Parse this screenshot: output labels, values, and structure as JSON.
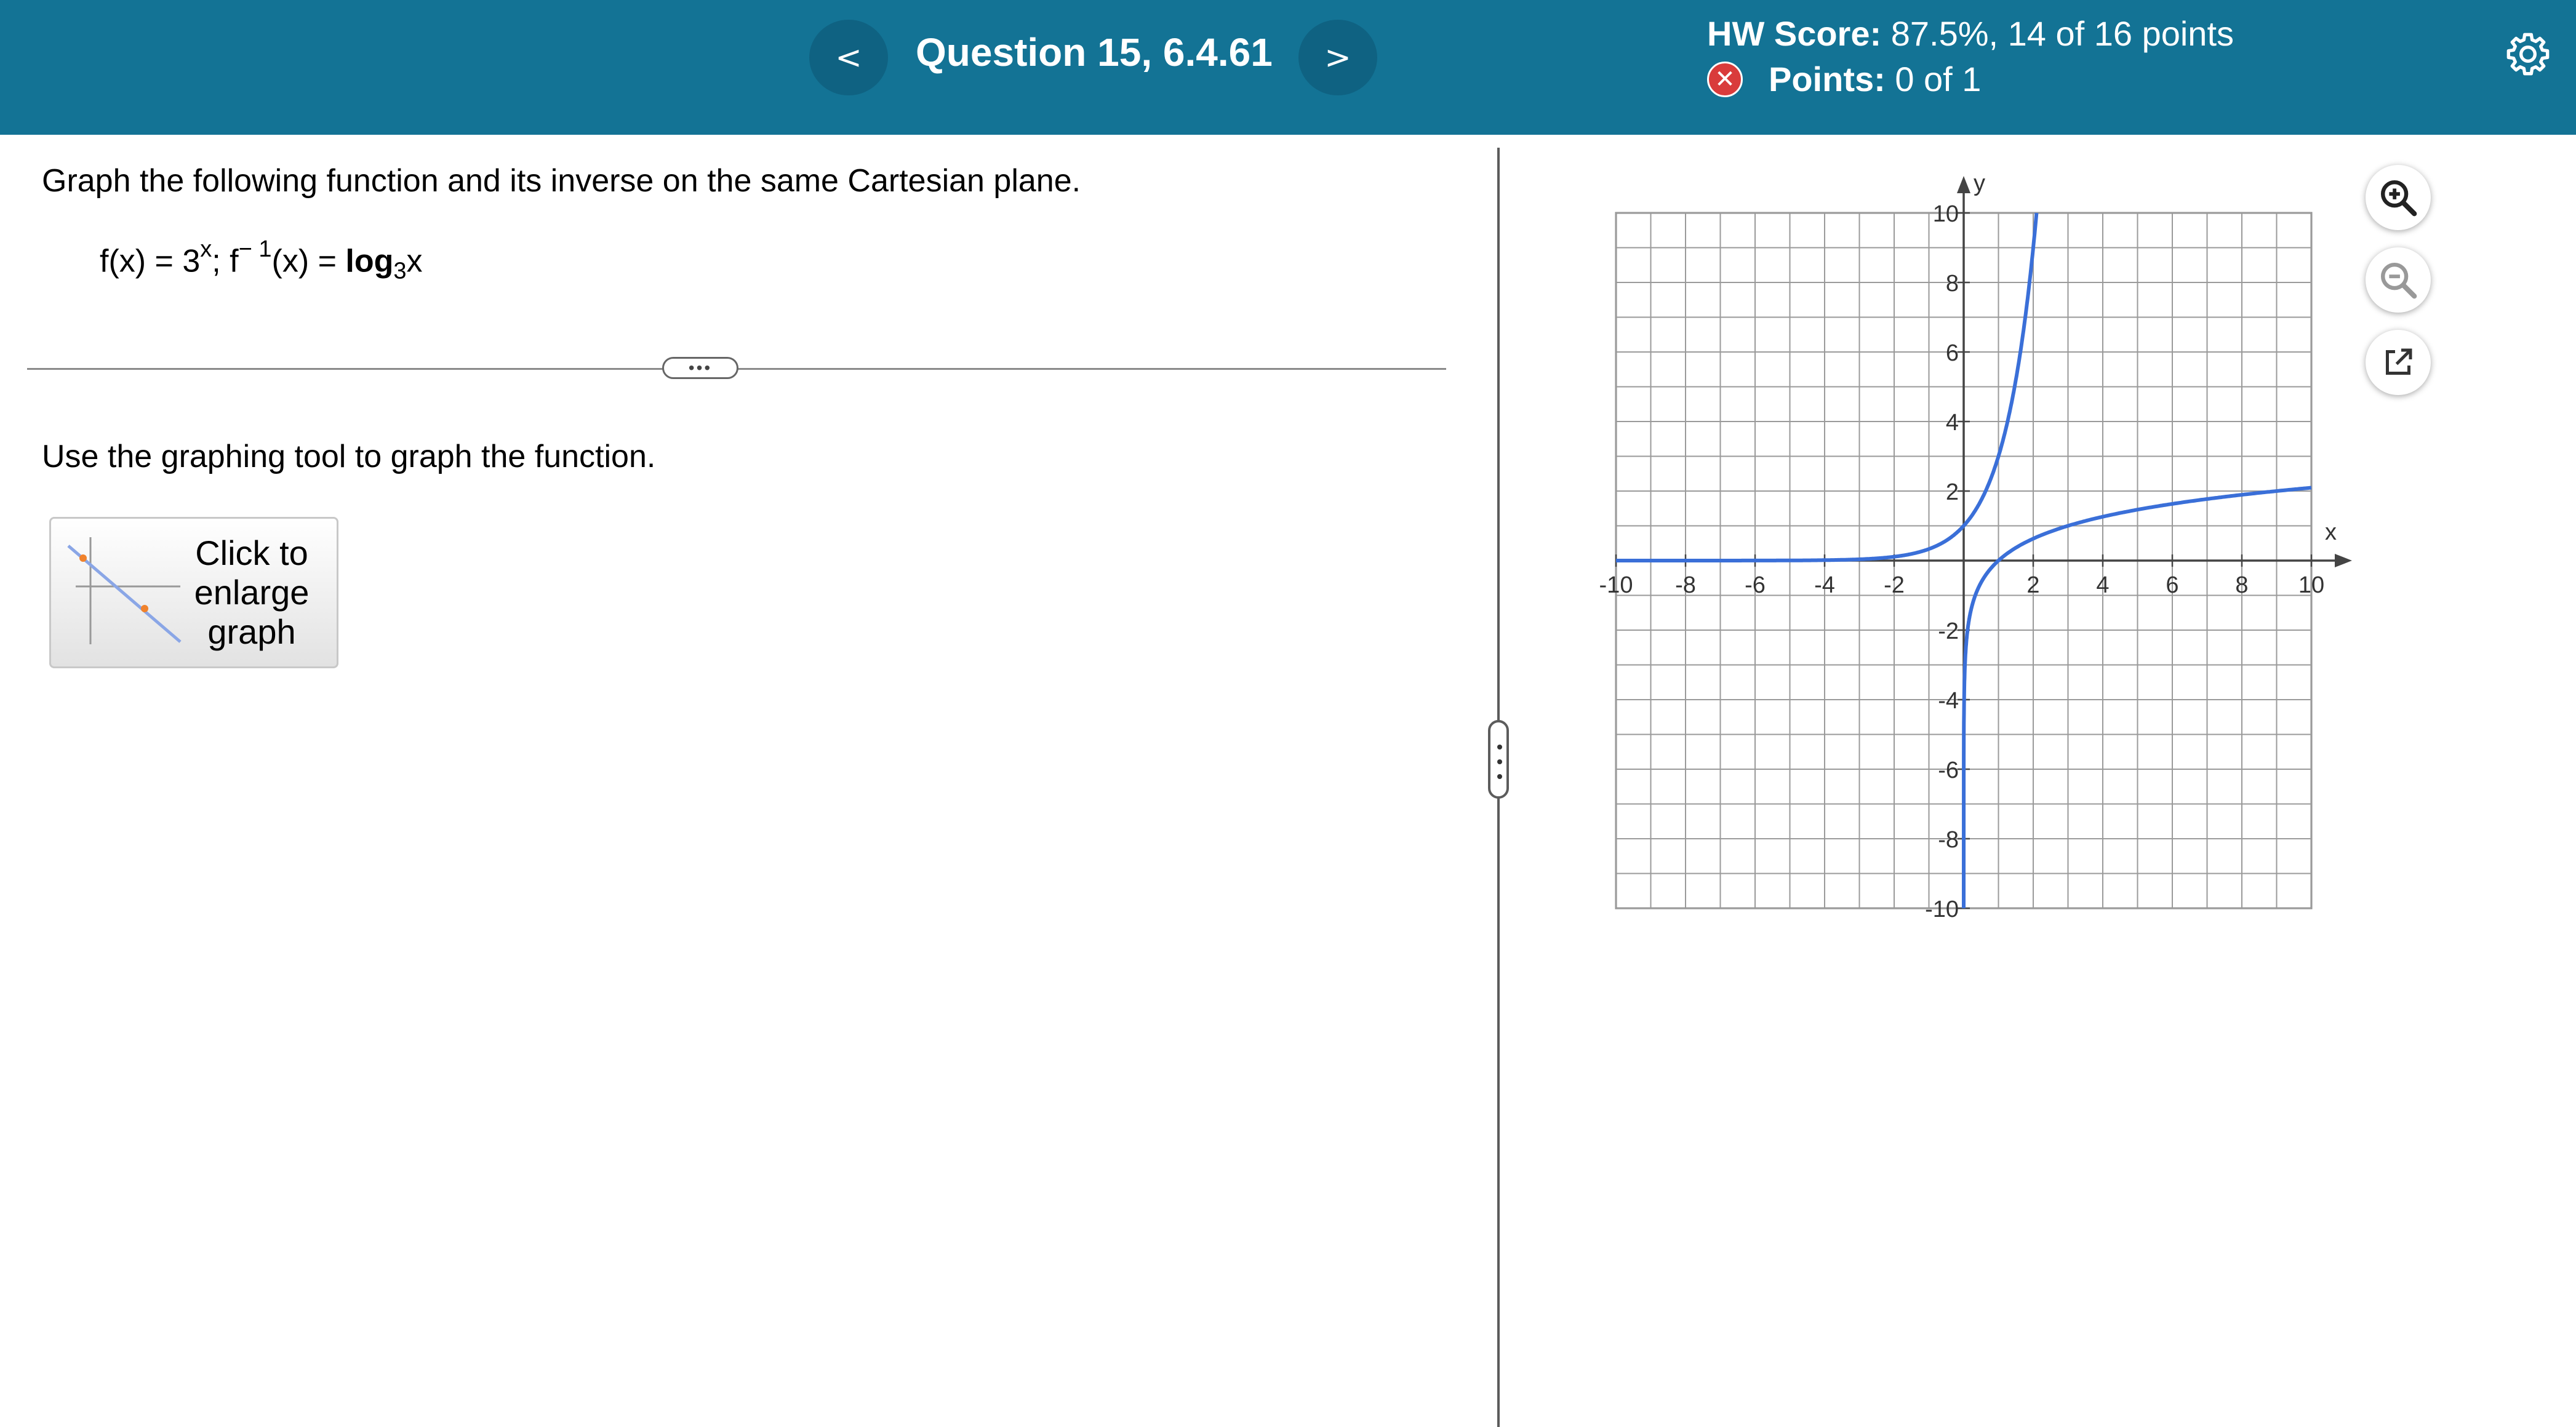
{
  "header": {
    "prev_label": "<",
    "next_label": ">",
    "question_title": "Question 15, 6.4.61",
    "hw_score_label": "HW Score:",
    "hw_score_value": "87.5%, 14 of 16 points",
    "points_label": "Points:",
    "points_value": "0 of 1",
    "points_status_icon": "x-circle-icon",
    "settings_icon": "gear-icon"
  },
  "problem": {
    "instruction": "Graph the following function and its inverse on the same Cartesian plane.",
    "f_lhs": "f(x) = 3",
    "f_exp": "x",
    "sep": "; f",
    "inv_sup": "− 1",
    "inv_lhs": "(x) = ",
    "log_word": "log",
    "log_base": "3",
    "log_arg": "x",
    "more_label": "•••",
    "tool_instruction": "Use the graphing tool to graph the function.",
    "enlarge_label": "Click to enlarge graph"
  },
  "chart_data": {
    "type": "line",
    "x_label": "x",
    "y_label": "y",
    "xlim": [
      -10,
      10
    ],
    "ylim": [
      -10,
      10
    ],
    "grid": true,
    "grid_step": 1,
    "x_ticks": [
      "-10",
      "-8",
      "-6",
      "-4",
      "-2",
      "2",
      "4",
      "6",
      "8",
      "10"
    ],
    "y_ticks": [
      "10",
      "8",
      "6",
      "4",
      "2",
      "-2",
      "-4",
      "-6",
      "-8",
      "-10"
    ],
    "series": [
      {
        "function": "3^x",
        "color": "#3a6fd8"
      },
      {
        "function": "log_3(x)",
        "color": "#3a6fd8"
      }
    ]
  },
  "tools": [
    {
      "icon": "zoom-in-icon"
    },
    {
      "icon": "zoom-out-icon"
    },
    {
      "icon": "external-link-icon"
    }
  ],
  "colors": {
    "header_bg": "#137395",
    "curve": "#3a6fd8",
    "error": "#d93b3b"
  }
}
